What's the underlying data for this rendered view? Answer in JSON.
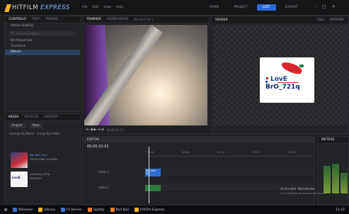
{
  "app": {
    "brand": "HITFILM",
    "edition": "EXPRESS"
  },
  "menu": [
    "File",
    "Edit",
    "View",
    "Help"
  ],
  "workspaces": [
    {
      "label": "HOME"
    },
    {
      "label": "PROJECT"
    },
    {
      "label": "EDIT"
    },
    {
      "label": "EXPORT"
    }
  ],
  "controls": {
    "tabs": [
      "CONTROLS",
      "TEXT",
      "TRACKS"
    ],
    "filter": "Active Grading",
    "search_placeholder": "Search Controls",
    "rows": [
      "No Project Set",
      "Transform",
      "Effects"
    ]
  },
  "media": {
    "tabs": [
      "MEDIA",
      "EFFECTS",
      "HISTORY"
    ],
    "buttons": [
      "Import",
      "New"
    ],
    "filter": "Arrange By Name",
    "group": "Group By Folder",
    "items": [
      {
        "name": "Bar Red Vid 1",
        "meta": "1920x1080 29.97fps",
        "selected": true
      },
      {
        "name": "Love Bro_721q",
        "meta": "500x500"
      }
    ]
  },
  "trimmer": {
    "tabs": [
      "TRIMMER",
      "AUDIO MIXER"
    ],
    "clip": "Bar Red Vid 1",
    "timecode": "00:00:01;17",
    "controls": "⏮ ◀ ▶ ⏭ ⏹"
  },
  "viewer": {
    "title": "VIEWER",
    "options": [
      "FULL",
      "OPTIONS"
    ],
    "zoom": "FULL",
    "logo": {
      "line1": "LovE",
      "line2": "BrO_721q"
    }
  },
  "timeline": {
    "title": "EDITOR",
    "timecode": "00;00;10;21",
    "tracks": [
      {
        "name": "Audio 1"
      },
      {
        "name": "Video 1"
      }
    ],
    "ruler": [
      "00:00",
      "00:05",
      "00:10",
      "00:15",
      "00:20"
    ],
    "clip_label": "Bar Red Vid"
  },
  "meters": {
    "title": "METERS",
    "levels": [
      0.55,
      0.6,
      0.42
    ]
  },
  "taskbar": {
    "items": [
      "Windows",
      "Library",
      "Hi Steven",
      "Spotify",
      "Red Bull",
      "HitFilm Express"
    ],
    "time": "11:42"
  },
  "activate": {
    "title": "Activate Windows",
    "sub": "Go to Settings to activate Windows."
  }
}
